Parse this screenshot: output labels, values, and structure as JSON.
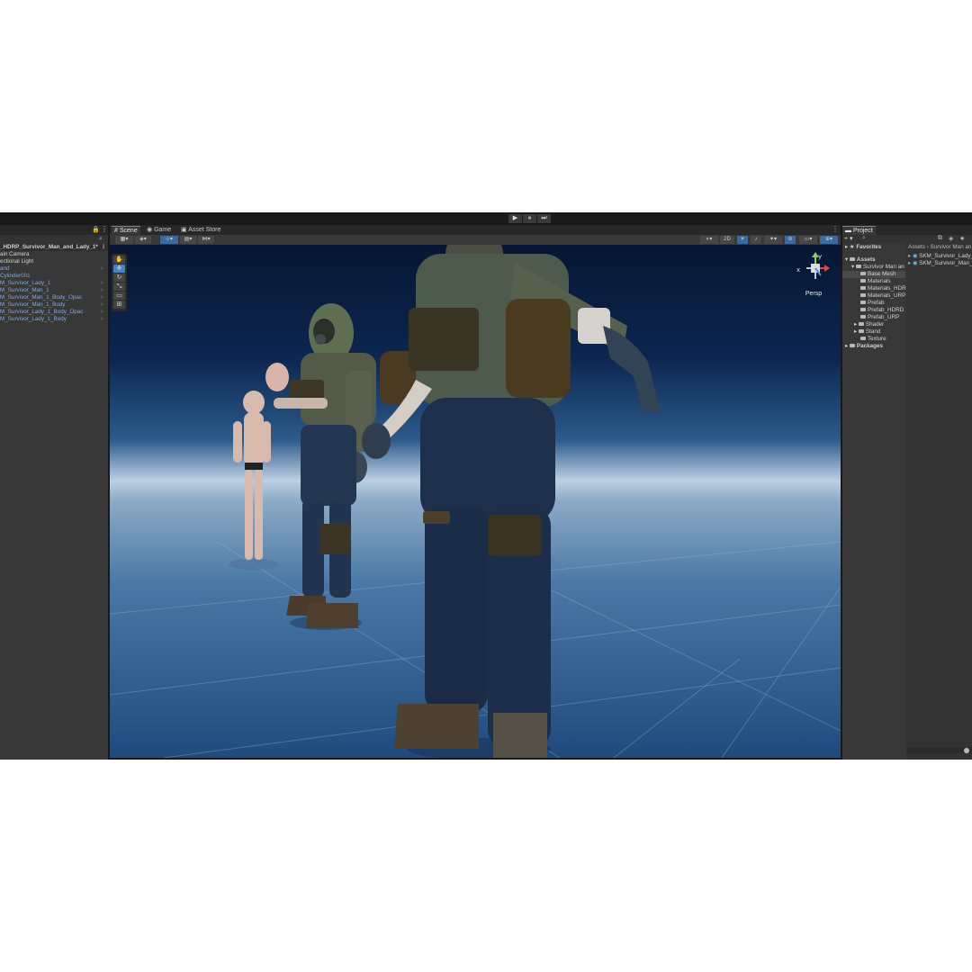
{
  "toolbar": {
    "play": "▶",
    "pause": "⏸",
    "step": "⏭"
  },
  "hierarchy": {
    "scene_name": "_HDRP_Survivor_Man_and_Lady_1*",
    "items": [
      {
        "label": "ain Camera",
        "prefab": false,
        "expandable": false
      },
      {
        "label": "ectional Light",
        "prefab": false,
        "expandable": false
      },
      {
        "label": "and",
        "prefab": true,
        "expandable": true
      },
      {
        "label": "Cylinder001",
        "prefab": true,
        "expandable": false
      },
      {
        "label": "M_Survivor_Lady_1",
        "prefab": true,
        "expandable": true
      },
      {
        "label": "M_Survivor_Man_1",
        "prefab": true,
        "expandable": true
      },
      {
        "label": "M_Survivor_Man_1_Body_Opac",
        "prefab": true,
        "expandable": true
      },
      {
        "label": "M_Survivor_Man_1_Body",
        "prefab": true,
        "expandable": true
      },
      {
        "label": "M_Survivor_Lady_1_Body_Opac",
        "prefab": true,
        "expandable": true
      },
      {
        "label": "M_Survivor_Lady_1_Body",
        "prefab": true,
        "expandable": true
      }
    ]
  },
  "tabs": {
    "scene": "Scene",
    "game": "Game",
    "asset_store": "Asset Store"
  },
  "scene_toolbar": {
    "mode_2d": "2D"
  },
  "gizmo": {
    "projection": "Persp",
    "x_label": "x",
    "y_label": "y"
  },
  "project": {
    "tab_label": "Project",
    "add_label": "+ ▾",
    "favorites": "Favorites",
    "assets": "Assets",
    "root_folder": "Survivor Man an",
    "folders": [
      "Base Mesh",
      "Materials",
      "Materials_HDR",
      "Materials_URP",
      "Prefab",
      "Prefab_HDRD",
      "Prefab_URP",
      "Shader",
      "Stand",
      "Texture"
    ],
    "selected_folder": "Base Mesh",
    "packages": "Packages",
    "breadcrumb": "Assets › Survivor Man an",
    "files": [
      "SKM_Survivor_Lady_",
      "SKM_Survivor_Man_"
    ]
  },
  "colors": {
    "accent": "#4a8ed6",
    "prefab_text": "#7fa9e6",
    "panel": "#383838",
    "header": "#282828"
  }
}
